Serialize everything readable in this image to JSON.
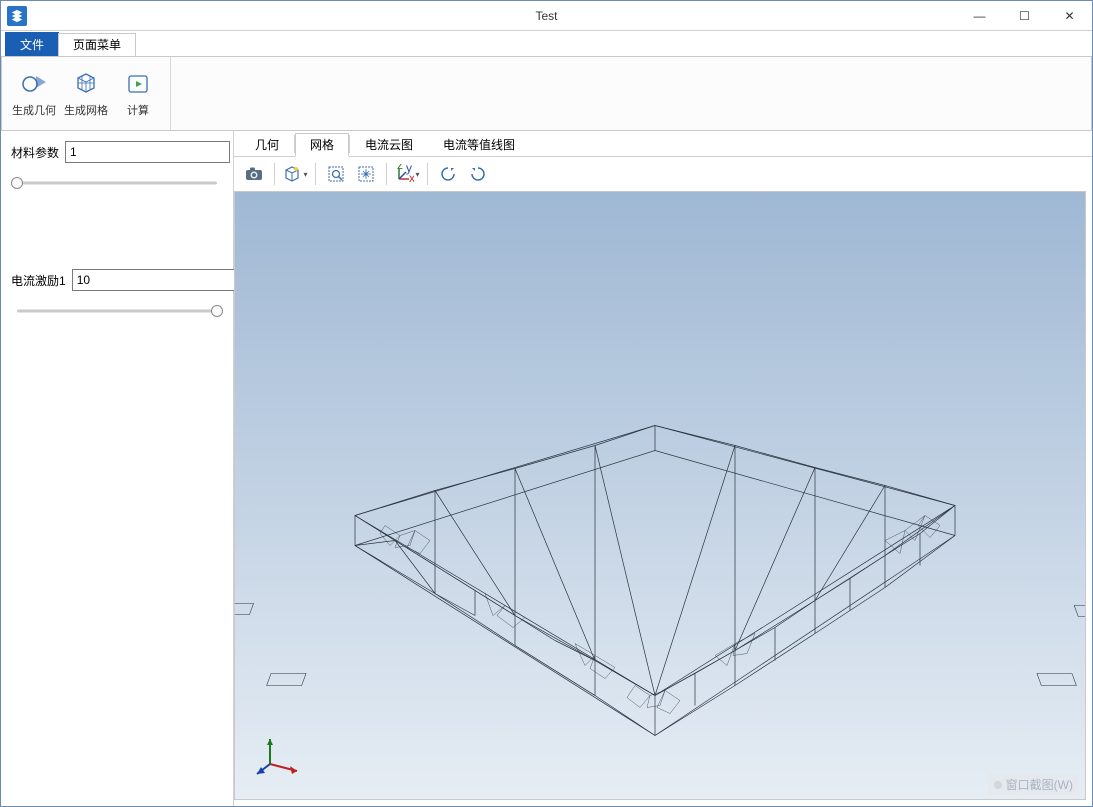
{
  "window": {
    "title": "Test"
  },
  "tabs": {
    "file": "文件",
    "pageMenu": "页面菜单"
  },
  "ribbon": {
    "genGeom": "生成几何",
    "genMesh": "生成网格",
    "compute": "计算"
  },
  "params": {
    "materialLabel": "材料参数",
    "materialValue": "1",
    "materialSliderPos": 3,
    "currentLabel": "电流激励1",
    "currentValue": "10",
    "currentSliderPos": 97
  },
  "viewTabs": {
    "geometry": "几何",
    "mesh": "网格",
    "currentCloud": "电流云图",
    "currentContour": "电流等值线图",
    "active": "mesh"
  },
  "toolbar3d": {
    "camera": "camera-icon",
    "scenelight": "scenelight-icon",
    "zoomWindow": "zoom-window-icon",
    "fitAll": "fit-all-icon",
    "axes": "axes-icon",
    "rotateCCW": "rotate-ccw-icon",
    "rotateCW": "rotate-cw-icon"
  },
  "watermark": "窗口截图(W)"
}
